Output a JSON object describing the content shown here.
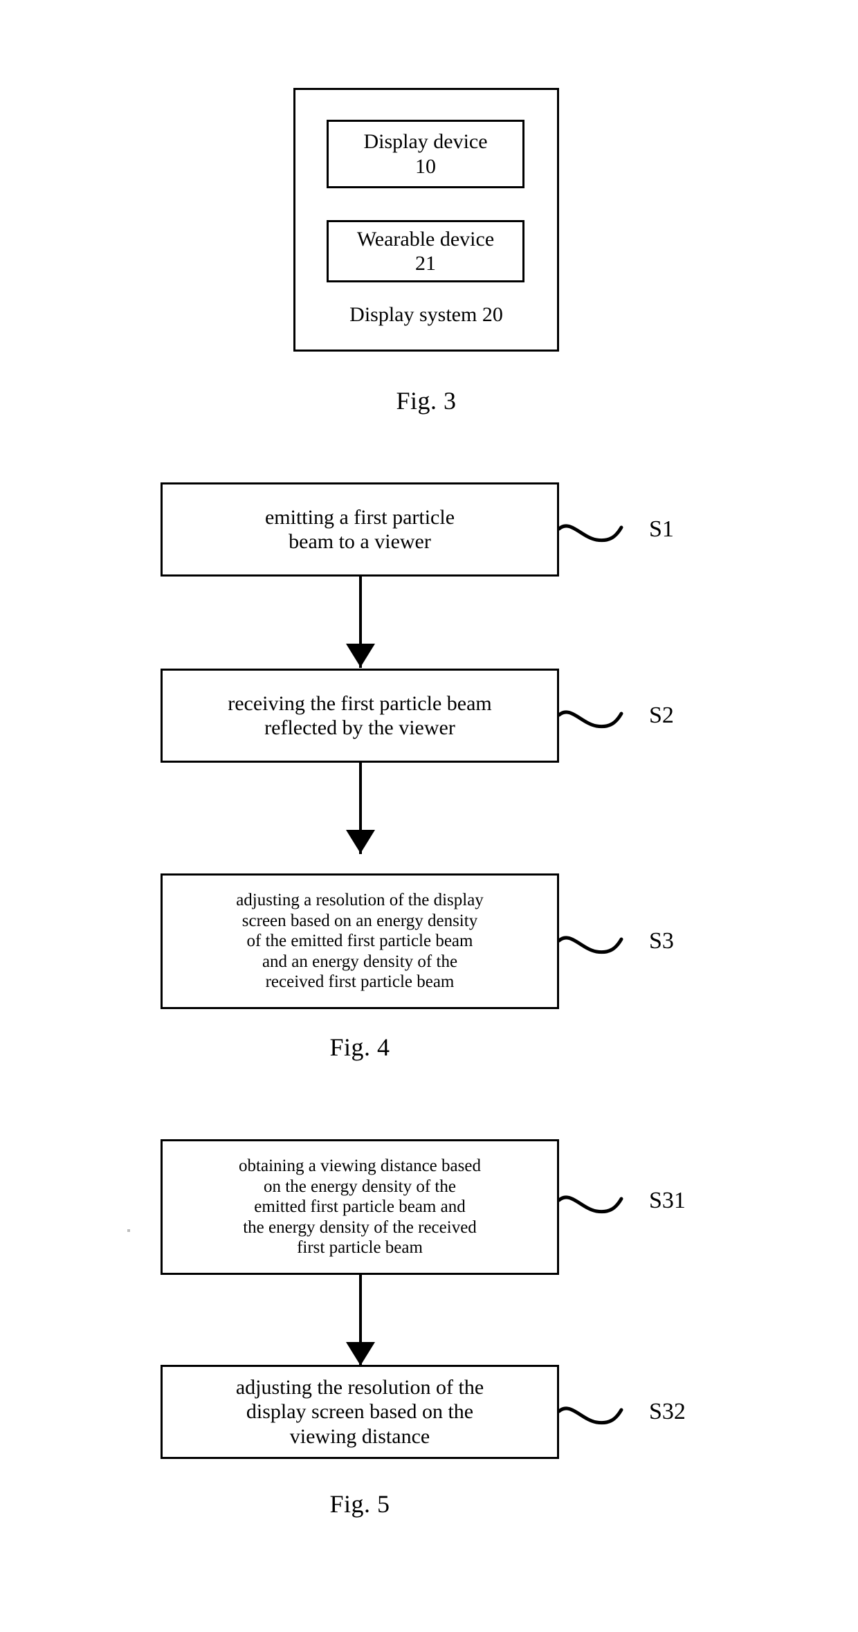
{
  "document": {
    "kind": "patent-drawing-sheet",
    "background_color": "#ffffff",
    "ink_color": "#000000"
  },
  "figures": [
    {
      "id": "fig3",
      "caption": "Fig. 3",
      "type": "block-diagram",
      "container_label": "Display system 20",
      "blocks": [
        {
          "id": "display-device",
          "label": "Display device\n10"
        },
        {
          "id": "wearable-device",
          "label": "Wearable device\n21"
        }
      ]
    },
    {
      "id": "fig4",
      "caption": "Fig. 4",
      "type": "flowchart",
      "steps": [
        {
          "ref": "S1",
          "text": "emitting a first particle\nbeam to a viewer"
        },
        {
          "ref": "S2",
          "text": "receiving the first particle beam\nreflected by the viewer"
        },
        {
          "ref": "S3",
          "text": "adjusting a resolution of the display\nscreen based on an energy density\nof the emitted first particle beam\nand an energy density of the\nreceived first particle beam"
        }
      ]
    },
    {
      "id": "fig5",
      "caption": "Fig. 5",
      "type": "flowchart",
      "steps": [
        {
          "ref": "S31",
          "text": "obtaining a viewing distance based\non the energy density of the\nemitted  first particle beam and\nthe energy density of the received\nfirst particle beam"
        },
        {
          "ref": "S32",
          "text": "adjusting the resolution of the\ndisplay screen based on the\nviewing distance"
        }
      ]
    }
  ]
}
